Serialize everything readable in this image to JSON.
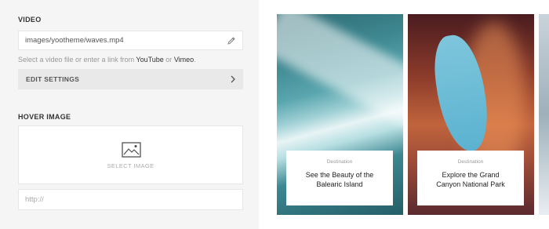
{
  "video": {
    "section_title": "VIDEO",
    "file_value": "images/yootheme/waves.mp4",
    "help_prefix": "Select a video file or enter a link from ",
    "help_youtube": "YouTube",
    "help_or": " or ",
    "help_vimeo": "Vimeo",
    "help_suffix": ".",
    "edit_settings_label": "EDIT SETTINGS"
  },
  "hover_image": {
    "section_title": "HOVER IMAGE",
    "select_label": "SELECT IMAGE",
    "url_placeholder": "http://"
  },
  "preview": {
    "cards": [
      {
        "meta": "Destination",
        "title": "See the Beauty of the Balearic Island"
      },
      {
        "meta": "Destination",
        "title": "Explore the Grand Canyon National Park"
      }
    ]
  },
  "icons": {
    "edit": "pencil-icon",
    "settings_arrow": "chevron-right-icon",
    "image_placeholder": "image-icon"
  }
}
